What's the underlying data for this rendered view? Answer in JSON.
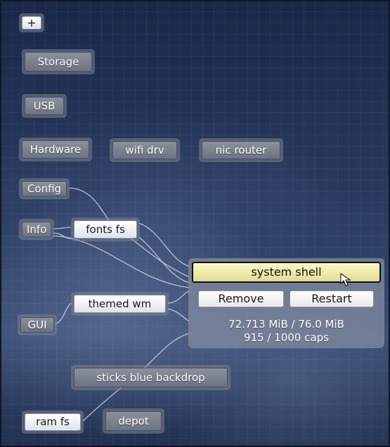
{
  "toolbar": {
    "add_label": "+"
  },
  "nodes": {
    "storage": "Storage",
    "usb": "USB",
    "hardware": "Hardware",
    "wifi_drv": "wifi drv",
    "nic_router": "nic router",
    "config": "Config",
    "info": "Info",
    "fonts_fs": "fonts fs",
    "gui": "GUI",
    "themed_wm": "themed wm",
    "sticks_blue_backdrop": "sticks blue backdrop",
    "ram_fs": "ram fs",
    "depot": "depot"
  },
  "popup": {
    "title": "system shell",
    "remove_label": "Remove",
    "restart_label": "Restart",
    "ram_usage": "72.713 MiB / 76.0 MiB",
    "caps_usage": "915 / 1000 caps"
  },
  "colors": {
    "background": "#2a3a60",
    "node_face": "#7a808c",
    "selected_face": "#ffffff",
    "popup_title": "#f3efb4"
  }
}
